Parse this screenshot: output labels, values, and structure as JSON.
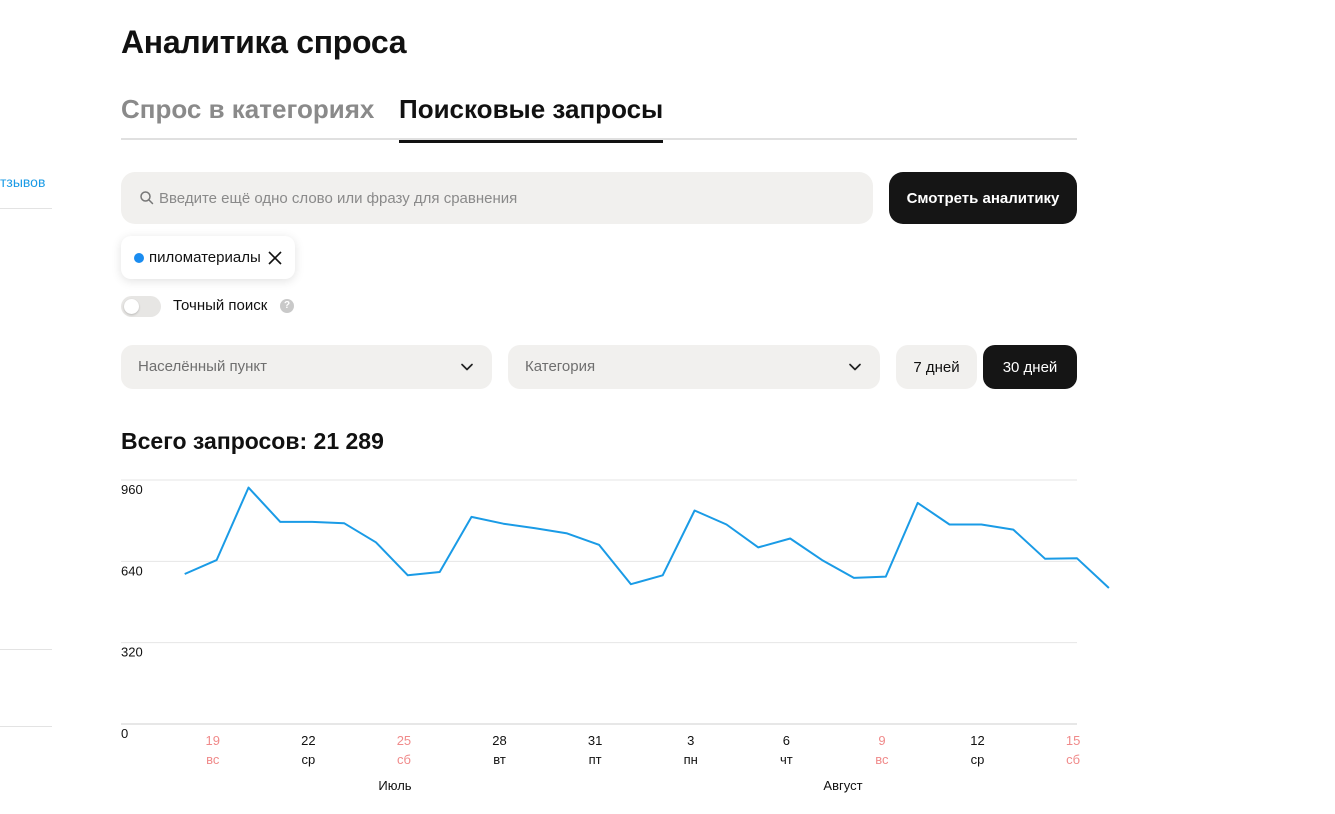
{
  "sidebar": {
    "link_label": "тзывов"
  },
  "page": {
    "title": "Аналитика спроса"
  },
  "tabs": [
    {
      "label": "Спрос в категориях",
      "active": false
    },
    {
      "label": "Поисковые запросы",
      "active": true
    }
  ],
  "search": {
    "placeholder": "Введите ещё одно слово или фразу для сравнения",
    "value": "",
    "button_label": "Смотреть аналитику",
    "icon": "search-icon"
  },
  "chips": [
    {
      "label": "пиломатериалы",
      "color": "#1a8cf0",
      "icon": "close-icon"
    }
  ],
  "exact_search": {
    "label": "Точный поиск",
    "enabled": false,
    "help_icon": "question-icon",
    "help_glyph": "?"
  },
  "filters": {
    "city_placeholder": "Населённый пункт",
    "category_placeholder": "Категория"
  },
  "period": {
    "options": [
      "7 дней",
      "30 дней"
    ],
    "selected": "30 дней"
  },
  "total": {
    "text": "Всего запросов: 21 289"
  },
  "colors": {
    "line": "#1a9be6",
    "weekend": "#f08a8a",
    "accent_dark": "#151515"
  },
  "chart_data": {
    "type": "line",
    "title": "",
    "xlabel": "",
    "ylabel": "",
    "ylim": [
      0,
      960
    ],
    "yticks": [
      0,
      320,
      640,
      960
    ],
    "grid": true,
    "x": [
      "2024-07-17",
      "2024-07-18",
      "2024-07-19",
      "2024-07-20",
      "2024-07-21",
      "2024-07-22",
      "2024-07-23",
      "2024-07-24",
      "2024-07-25",
      "2024-07-26",
      "2024-07-27",
      "2024-07-28",
      "2024-07-29",
      "2024-07-30",
      "2024-07-31",
      "2024-08-01",
      "2024-08-02",
      "2024-08-03",
      "2024-08-04",
      "2024-08-05",
      "2024-08-06",
      "2024-08-07",
      "2024-08-08",
      "2024-08-09",
      "2024-08-10",
      "2024-08-11",
      "2024-08-12",
      "2024-08-13",
      "2024-08-14",
      "2024-08-15",
      "2024-08-16"
    ],
    "series": [
      {
        "values": [
          590,
          645,
          930,
          795,
          795,
          790,
          715,
          585,
          598,
          815,
          788,
          770,
          750,
          705,
          550,
          585,
          840,
          785,
          695,
          730,
          645,
          575,
          580,
          870,
          785,
          785,
          765,
          650,
          652,
          535
        ]
      }
    ],
    "x_ticks": [
      {
        "day": "19",
        "weekday": "вс",
        "weekend": true
      },
      {
        "day": "22",
        "weekday": "ср",
        "weekend": false
      },
      {
        "day": "25",
        "weekday": "сб",
        "weekend": true
      },
      {
        "day": "28",
        "weekday": "вт",
        "weekend": false
      },
      {
        "day": "31",
        "weekday": "пт",
        "weekend": false
      },
      {
        "day": "3",
        "weekday": "пн",
        "weekend": false
      },
      {
        "day": "6",
        "weekday": "чт",
        "weekend": false
      },
      {
        "day": "9",
        "weekday": "вс",
        "weekend": true
      },
      {
        "day": "12",
        "weekday": "ср",
        "weekend": false
      },
      {
        "day": "15",
        "weekday": "сб",
        "weekend": true
      }
    ],
    "months": [
      "Июль",
      "Август"
    ]
  }
}
